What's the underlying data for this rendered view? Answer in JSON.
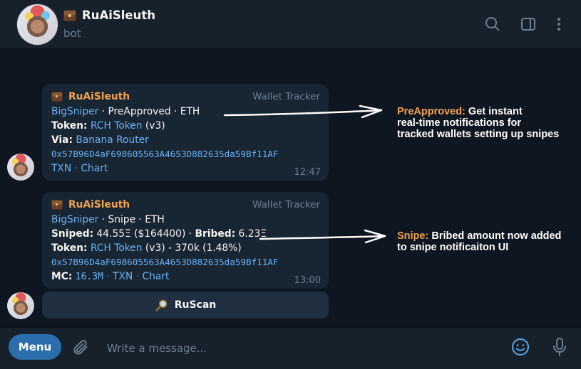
{
  "header": {
    "title": "RuAiSleuth",
    "subtitle": "bot",
    "icons": [
      "search-icon",
      "sidebar-panel-icon",
      "more-vertical-icon"
    ]
  },
  "messages": [
    {
      "sender": "RuAiSleuth",
      "tag": "Wallet Tracker",
      "line1": {
        "wallet": "BigSniper",
        "rest": " · PreApproved · ETH"
      },
      "token_label": "Token:",
      "token_name": "RCH Token",
      "token_version": " (v3)",
      "via_label": "Via:",
      "via_value": "Banana Router",
      "address": "0x57B96D4aF698605563A4653D882635da59Bf11AF",
      "txn": "TXN",
      "sep": " · ",
      "chart": "Chart",
      "time": "12:47"
    },
    {
      "sender": "RuAiSleuth",
      "tag": "Wallet Tracker",
      "line1": {
        "wallet": "BigSniper",
        "rest": " · Snipe · ETH"
      },
      "sniped_label": "Sniped:",
      "sniped_value": " 44.55Ξ ($164400) · ",
      "bribed_label": "Bribed:",
      "bribed_value": " 6.23Ξ",
      "token_label": "Token:",
      "token_name": "RCH Token",
      "token_rest": " (v3) - 370k (1.48%)",
      "address": "0x57B96D4aF698605563A4653D882635da59Bf11AF",
      "mc_label": "MC:",
      "mc_value": "16.3M",
      "txn": "TXN",
      "sep": " · ",
      "chart": "Chart",
      "time": "13:00"
    }
  ],
  "inline_button": {
    "icon": "magnifier-icon",
    "label": "RuScan"
  },
  "annotations": [
    {
      "highlight": "PreApproved:",
      "line1": " Get instant",
      "line2": "real-time notifications for",
      "line3": "tracked wallets setting up snipes"
    },
    {
      "highlight": "Snipe:",
      "line1": " Bribed amount now added",
      "line2": "to snipe notificaiton UI"
    }
  ],
  "composer": {
    "menu_label": "Menu",
    "placeholder": "Write a message...",
    "icons": [
      "paperclip-icon",
      "emoji-icon",
      "microphone-icon"
    ]
  },
  "colors": {
    "background": "#0e1621",
    "panel": "#17212b",
    "bubble": "#182533",
    "accent_orange": "#f4a24a",
    "link_blue": "#6ab3f3",
    "menu_blue": "#2b6eab",
    "muted": "#6d7f8f"
  }
}
